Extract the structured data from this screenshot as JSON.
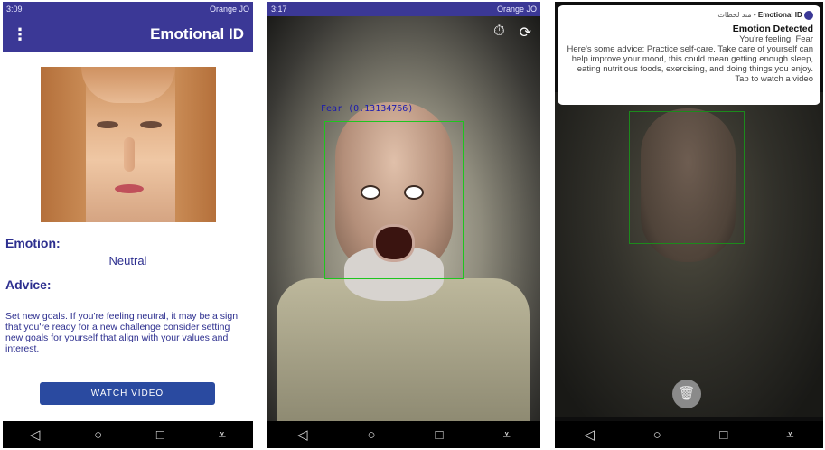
{
  "screen1": {
    "status": {
      "time": "3:09",
      "carrier": "Orange JO"
    },
    "appbar": {
      "menu_icon": "more-vert-icon",
      "title": "Emotional ID"
    },
    "emotion_label": "Emotion:",
    "emotion_value": "Neutral",
    "advice_label": "Advice:",
    "advice_text": "Set new goals. If you're feeling neutral, it may be a sign that you're ready for a new challenge consider setting new goals for yourself that align with your values and interest.",
    "watch_button": "WATCH VIDEO"
  },
  "screen2": {
    "status": {
      "time": "3:17",
      "carrier": "Orange JO"
    },
    "detection_label": "Fear (0.13134766)",
    "icons": [
      "timer-icon",
      "switch-camera-icon"
    ]
  },
  "screen3": {
    "notification": {
      "app": "Emotional ID",
      "source": "مند لحظات",
      "title": "Emotion Detected",
      "line1": "You're feeling: Fear",
      "line2": "Here's some advice: Practice self-care. Take care of yourself can help improve your mood, this could mean getting enough sleep, eating nutritious foods, exercising, and doing things you enjoy.",
      "line3": "Tap to watch a video"
    },
    "trash_icon": "delete-icon"
  },
  "nav": {
    "back": "◁",
    "home": "○",
    "recents": "□",
    "extra1": "⩡",
    "extra2": "⩡"
  }
}
